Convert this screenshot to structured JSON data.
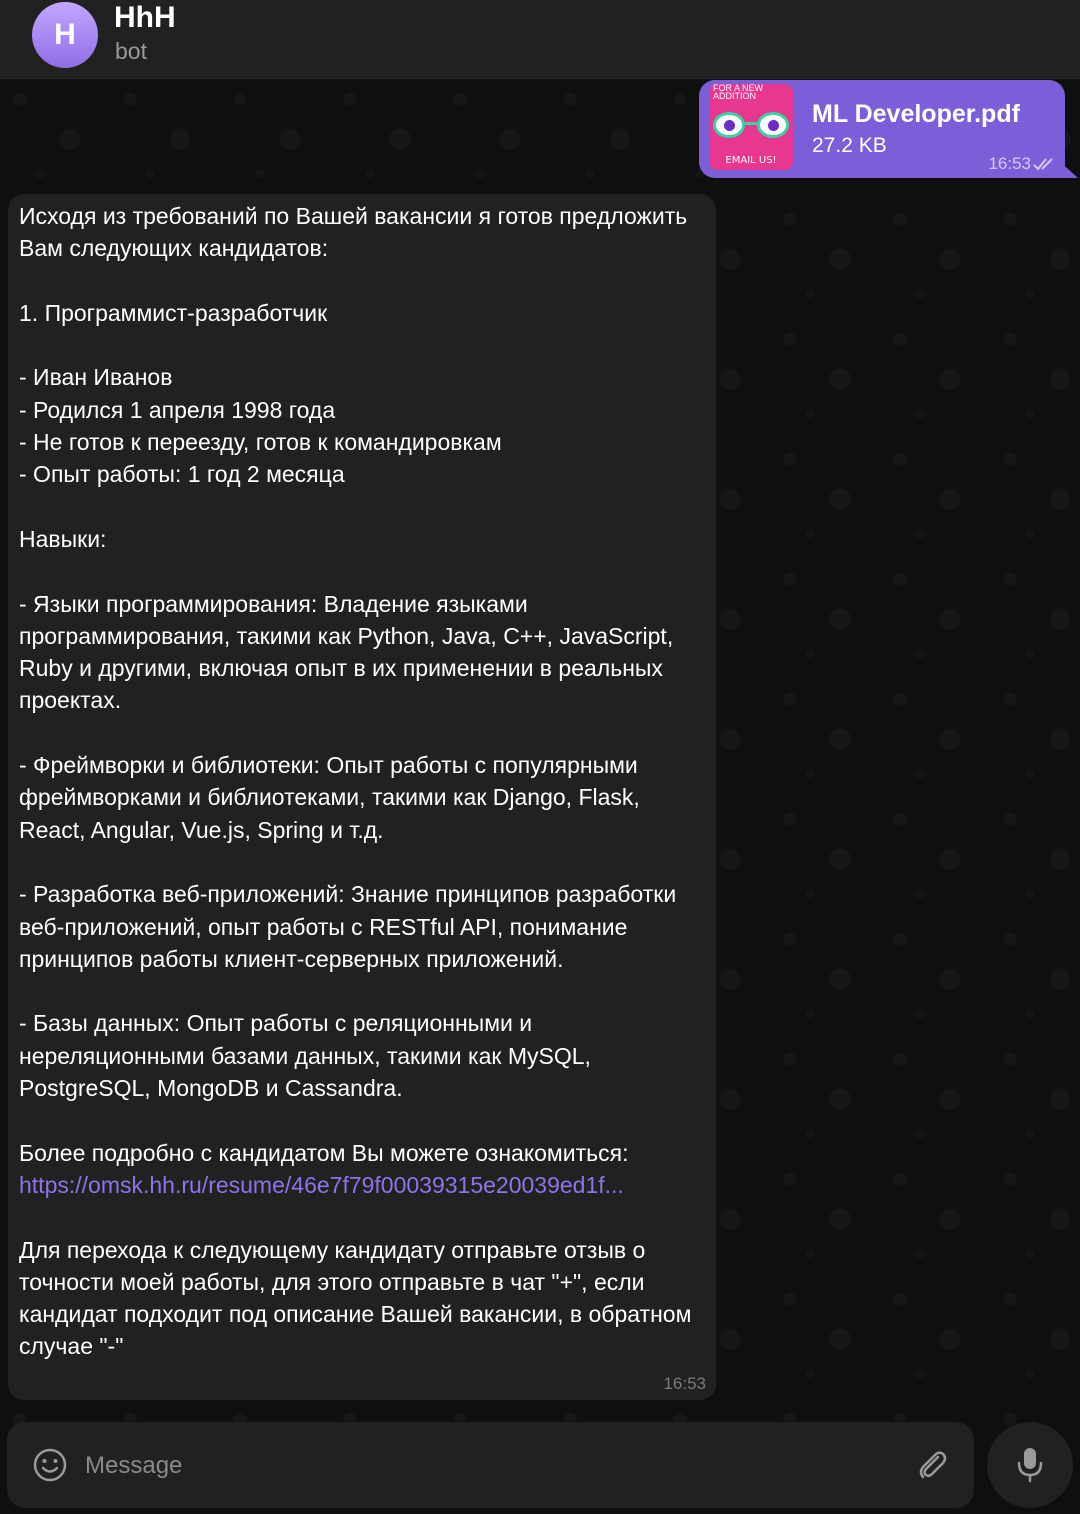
{
  "header": {
    "avatar_letter": "H",
    "chat_name": "HhH",
    "chat_status": "bot"
  },
  "outgoing_message": {
    "file_name": "ML Developer.pdf",
    "file_size": "27.2 KB",
    "time": "16:53",
    "thumbnail_top_text": "FOR A NEW ADDITION",
    "thumbnail_bottom_text": "EMAIL US!",
    "status_icon": "double-check-icon"
  },
  "incoming_message": {
    "text_before_link": "Исходя из требований по Вашей вакансии я готов предложить Вам следующих кандидатов:\n\n1. Программист-разработчик\n\n- Иван Иванов\n- Родился 1 апреля 1998 года\n- Не готов к переезду, готов к командировкам\n- Опыт работы: 1 год 2 месяца\n\nНавыки:\n\n- Языки программирования: Владение языками программирования, такими как Python, Java, C++, JavaScript, Ruby и другими, включая опыт в их применении в реальных проектах.\n\n- Фреймворки и библиотеки: Опыт работы с популярными фреймворками и библиотеками, такими как Django, Flask, React, Angular, Vue.js, Spring и т.д.\n\n- Разработка веб-приложений: Знание принципов разработки веб-приложений, опыт работы с RESTful API, понимание принципов работы клиент-серверных приложений.\n\n- Базы данных: Опыт работы с реляционными и нереляционными базами данных, такими как MySQL, PostgreSQL, MongoDB и Cassandra.\n\nБолее подробно с кандидатом Вы можете ознакомиться:\n",
    "link": "https://omsk.hh.ru/resume/46e7f79f00039315e20039ed1f...",
    "text_after_link": "\n\nДля перехода к следующему кандидату отправьте отзыв о точности моей работы, для этого отправьте в чат \"+\", если кандидат подходит под описание Вашей вакансии, в обратном случае \"-\"",
    "time": "16:53"
  },
  "composer": {
    "placeholder": "Message",
    "emoji_icon": "smile-icon",
    "attach_icon": "paperclip-icon",
    "mic_icon": "microphone-icon"
  },
  "colors": {
    "outgoing_bubble": "#7c5fd8",
    "incoming_bubble": "#212121",
    "link": "#8e74e8",
    "background": "#0f0f0f"
  }
}
